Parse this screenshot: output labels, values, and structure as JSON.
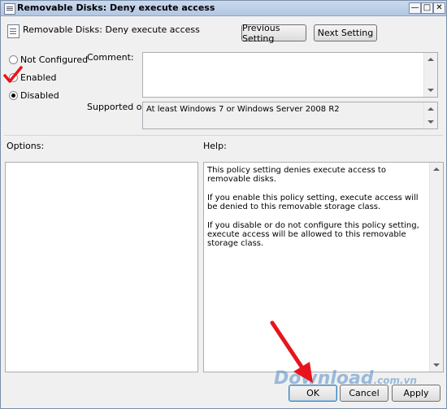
{
  "window": {
    "title": "Removable Disks: Deny execute access",
    "minimize_icon": "minimize-icon",
    "maximize_icon": "maximize-icon",
    "close_icon": "close-icon"
  },
  "header": {
    "policy_name": "Removable Disks: Deny execute access",
    "previous_label": "Previous Setting",
    "next_label": "Next Setting"
  },
  "state": {
    "options": [
      {
        "label": "Not Configured",
        "selected": false
      },
      {
        "label": "Enabled",
        "selected": true
      },
      {
        "label": "Disabled",
        "selected": false
      }
    ]
  },
  "comment": {
    "label": "Comment:",
    "value": ""
  },
  "supported": {
    "label": "Supported on:",
    "value": "At least Windows 7 or Windows Server 2008 R2"
  },
  "options_panel": {
    "label": "Options:"
  },
  "help_panel": {
    "label": "Help:",
    "paragraphs": [
      "This policy setting denies execute access to removable disks.",
      "If you enable this policy setting, execute access will be denied to this removable storage class.",
      "If you disable or do not configure this policy setting, execute access will be allowed to this removable storage class."
    ]
  },
  "footer": {
    "ok_label": "OK",
    "cancel_label": "Cancel",
    "apply_label": "Apply"
  },
  "watermark": {
    "text": "Download",
    "suffix": ".com.vn"
  },
  "annotations": {
    "accent_color": "#e8141c"
  }
}
